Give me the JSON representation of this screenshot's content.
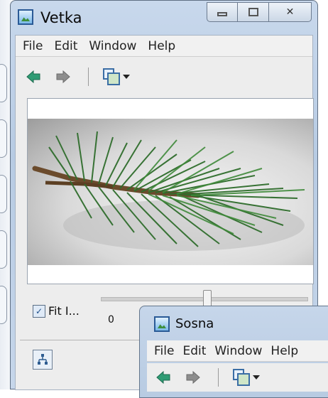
{
  "main_window": {
    "title": "Vetka",
    "menu": [
      "File",
      "Edit",
      "Window",
      "Help"
    ],
    "toolbar": {
      "back_icon": "arrow-left-icon",
      "forward_icon": "arrow-right-icon",
      "view_icon": "view-mode-icon"
    },
    "fit_label": "Fit I...",
    "fit_checked": true,
    "slider_min": "0"
  },
  "secondary_window": {
    "title": "Sosna",
    "menu": [
      "File",
      "Edit",
      "Window",
      "Help"
    ]
  },
  "colors": {
    "title_blue": "#c8d8ec",
    "nav_green": "#2f9c74"
  }
}
